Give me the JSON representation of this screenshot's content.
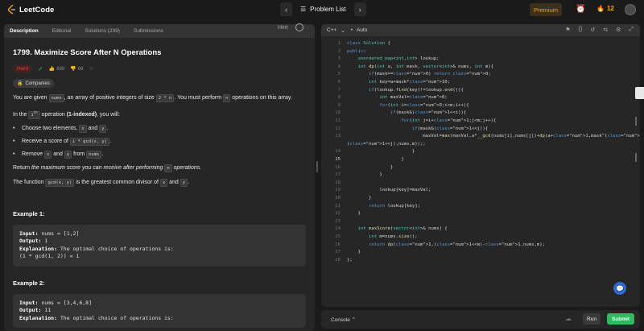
{
  "app": {
    "logo_text": "LeetCode"
  },
  "nav": {
    "problem_list": "Problem List",
    "premium": "Premium",
    "streak": "12"
  },
  "tabs": [
    "Description",
    "Editorial",
    "Solutions (299)",
    "Submissions"
  ],
  "problem": {
    "title": "1799. Maximize Score After N Operations",
    "hint": "Hint",
    "difficulty": "Hard",
    "likes": "888",
    "dislikes": "68",
    "companies": "Companies",
    "p1_a": "You are given ",
    "p1_code1": "nums",
    "p1_b": ", an array of positive integers of size ",
    "p1_code2": "2 * n",
    "p1_c": ". You must perform ",
    "p1_code3": "n",
    "p1_d": " operations on this array.",
    "p2_a": "In the ",
    "p2_sup": "i",
    "p2_supth": "th",
    "p2_b": " operation ",
    "p2_bold": "(1-indexed)",
    "p2_c": ", you will:",
    "b1_a": "Choose two elements, ",
    "b1_c1": "x",
    "b1_b": " and ",
    "b1_c2": "y",
    "b1_c": ".",
    "b2_a": "Receive a score of ",
    "b2_c1": "i * gcd(x, y)",
    "b2_b": ".",
    "b3_a": "Remove ",
    "b3_c1": "x",
    "b3_b": " and ",
    "b3_c2": "y",
    "b3_c": " from ",
    "b3_c3": "nums",
    "b3_d": ".",
    "p3_a": "Return ",
    "p3_i": "the maximum score you can receive after performing ",
    "p3_c1": "n",
    "p3_i2": " operations.",
    "p4_a": "The function ",
    "p4_c1": "gcd(x, y)",
    "p4_b": " is the greatest common divisor of ",
    "p4_c2": "x",
    "p4_c": " and ",
    "p4_c3": "y",
    "p4_d": ".",
    "ex1_title": "Example 1:",
    "ex1_input_label": "Input:",
    "ex1_input": " nums = [1,2]",
    "ex1_output_label": "Output:",
    "ex1_output": " 1",
    "ex1_expl_label": "Explanation:",
    "ex1_expl": " The optimal choice of operations is:",
    "ex1_expl2": "(1 * gcd(1, 2)) = 1",
    "ex2_title": "Example 2:",
    "ex2_input_label": "Input:",
    "ex2_input": " nums = [3,4,6,8]",
    "ex2_output_label": "Output:",
    "ex2_output": " 11",
    "ex2_expl_label": "Explanation:",
    "ex2_expl": " The optimal choice of operations is:"
  },
  "editor": {
    "language": "C++",
    "auto": "Auto"
  },
  "code_lines": [
    "class Solution {",
    "public:",
    "    unordered_map<int,int> lookup;",
    "    int dp(int a, int mask, vector<int>& nums, int m){",
    "        if(mask==0) return 0;",
    "        int key=a+mask*10;",
    "        if(lookup.find(key)!=lookup.end()){",
    "            int maxVal=0;",
    "            for(int i=0;i<m;i++){",
    "                if(mask&(1<<i)){",
    "                    for(int j=i+1;j<m;j++){",
    "                        if(mask&(1<<j)){",
    "                            maxVal=max(maxVal,a*__gcd(nums[i],nums[j])+dp(a+1,mask^(1<<i)^",
    "(1<<j),nums,m));;",
    "                        }",
    "                    }",
    "                }",
    "            }",
    "",
    "            lookup[key]=maxVal;",
    "        }",
    "        return lookup[key];",
    "    }",
    "",
    "    int maxScore(vector<int>& nums) {",
    "        int m=nums.size();",
    "        return dp(1,(1<<m)-1,nums,m);",
    "    }",
    "};"
  ],
  "line_numbers": [
    "1",
    "2",
    "3",
    "4",
    "5",
    "6",
    "7",
    "8",
    "9",
    "10",
    "11",
    "12",
    "13",
    "",
    "14",
    "15",
    "16",
    "17",
    "18",
    "19",
    "20",
    "21",
    "22",
    "23",
    "24",
    "25",
    "26",
    "27",
    "28"
  ],
  "console": {
    "label": "Console",
    "run": "Run",
    "submit": "Submit"
  }
}
